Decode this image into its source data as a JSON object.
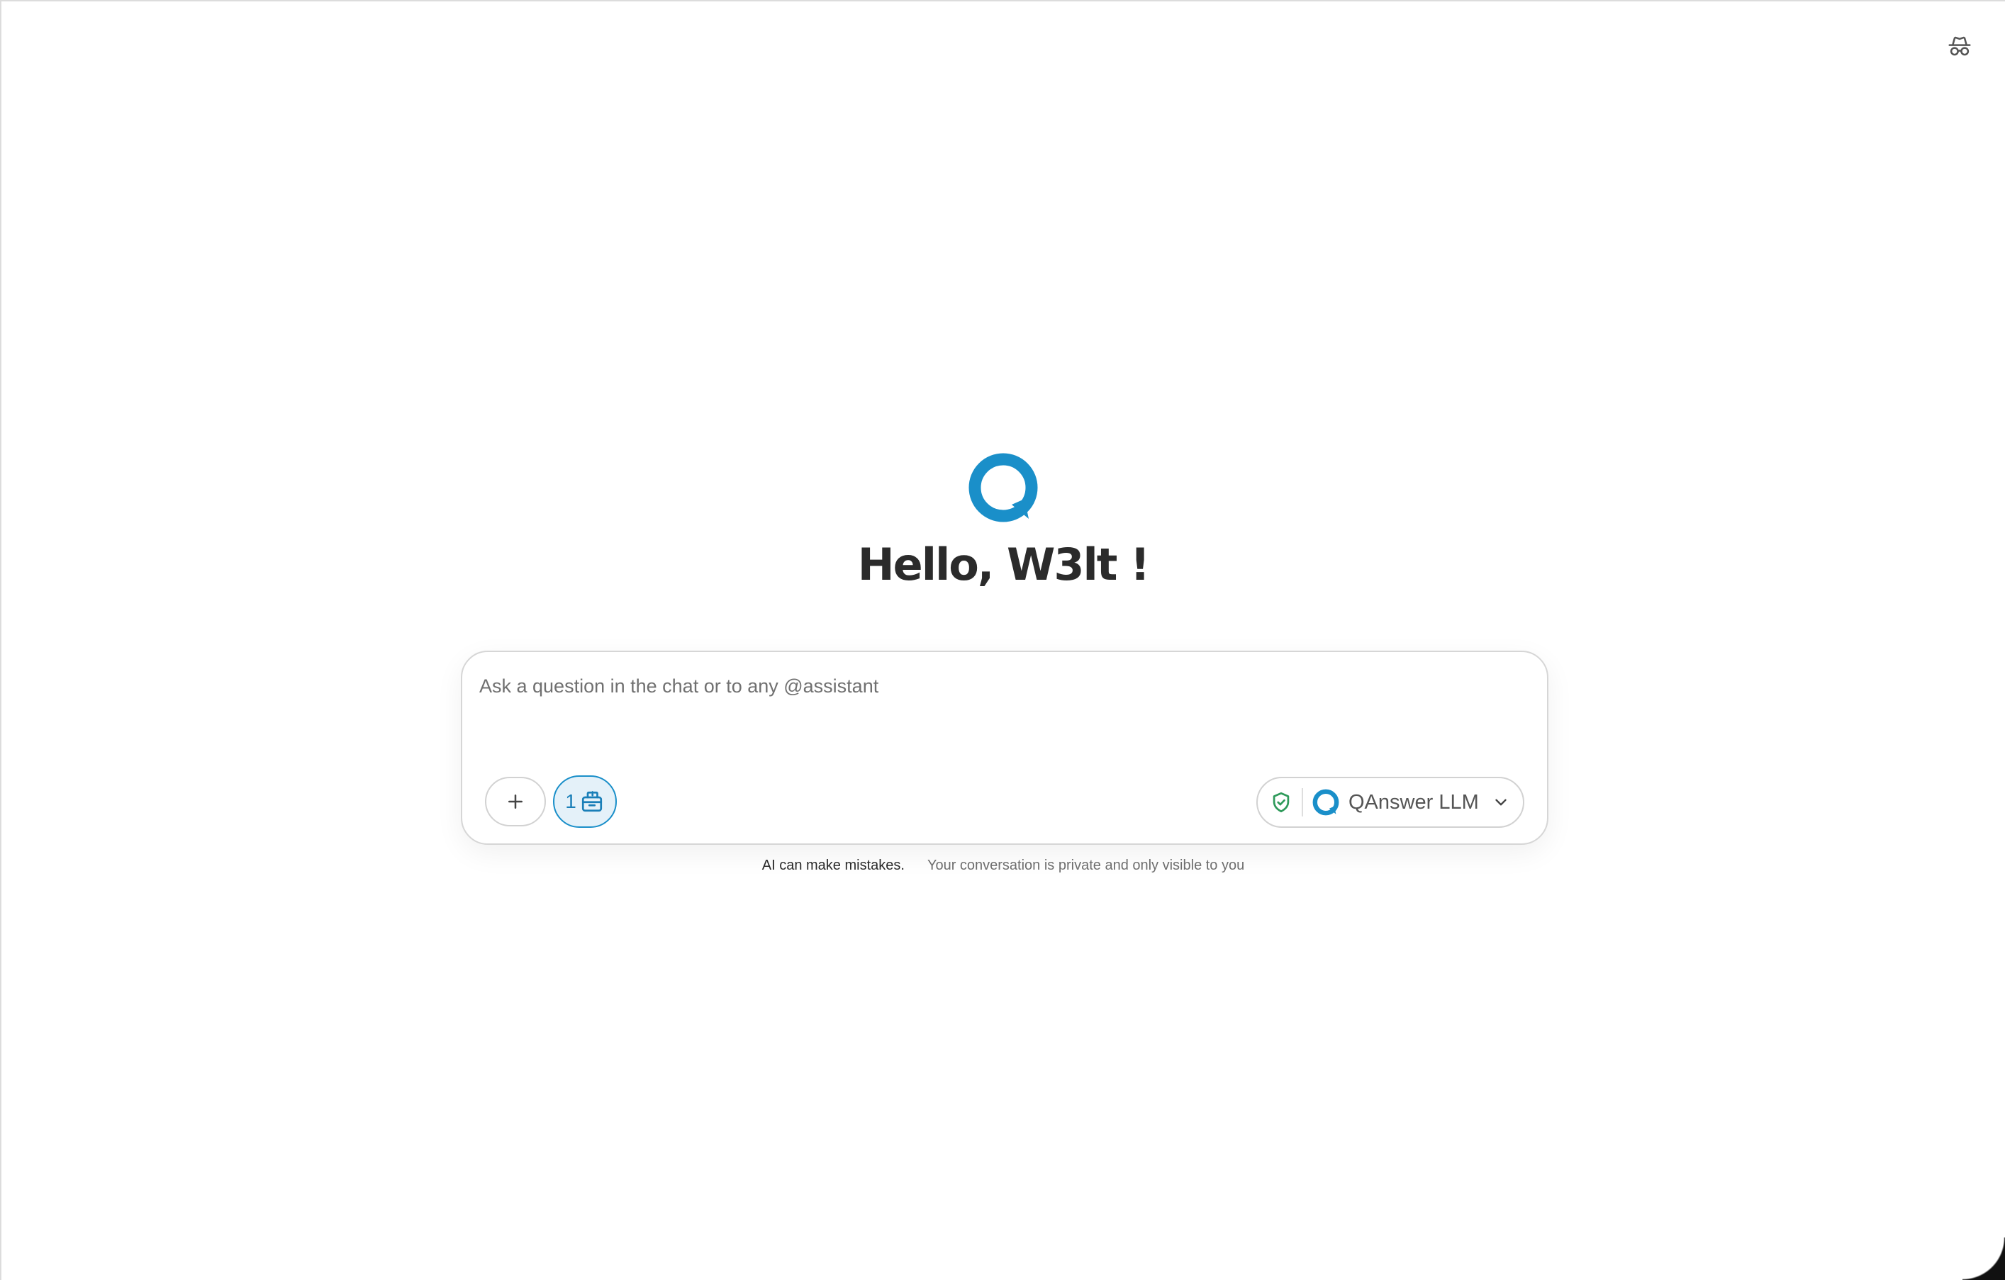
{
  "header": {
    "incognito_icon": "incognito-icon"
  },
  "hero": {
    "logo_icon": "qanswer-logo-icon",
    "greeting": "Hello, W3lt !"
  },
  "composer": {
    "placeholder": "Ask a question in the chat or to any @assistant",
    "value": "",
    "add_icon": "plus-icon",
    "knowledge_count": "1",
    "knowledge_icon": "knowledge-box-icon",
    "privacy_shield_icon": "shield-check-icon",
    "model": {
      "name": "QAnswer LLM",
      "icon": "qanswer-logo-icon",
      "chevron_icon": "chevron-down-icon"
    }
  },
  "footer": {
    "warning": "AI can make mistakes.",
    "privacy": "Your conversation is private and only visible to you"
  },
  "colors": {
    "brand": "#1a8fc9",
    "shield": "#2e9a5a",
    "text_dark": "#2b2b2b"
  }
}
